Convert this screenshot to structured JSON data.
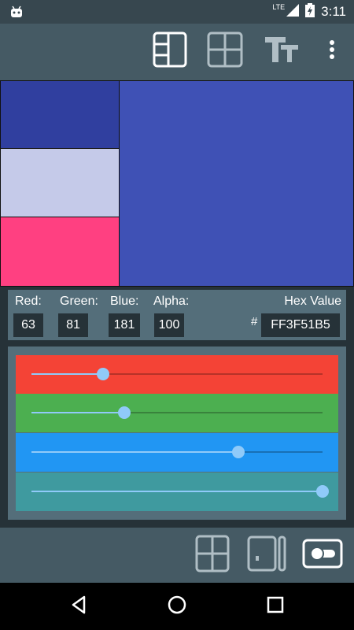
{
  "status": {
    "network": "LTE",
    "time": "3:11"
  },
  "colors": {
    "primary": "#3f51b5",
    "swatch_dark": "#303f9f",
    "swatch_light": "#c5cae9",
    "swatch_accent": "#ff4081",
    "slider_red": "#f44336",
    "slider_green": "#4caf50",
    "slider_blue": "#2196f3",
    "slider_alpha": "#3f9a9f"
  },
  "toolbar": {
    "icons": [
      "layout-split-icon",
      "grid-icon",
      "text-size-icon",
      "more-vert-icon"
    ]
  },
  "values": {
    "red_label": "Red:",
    "green_label": "Green:",
    "blue_label": "Blue:",
    "alpha_label": "Alpha:",
    "hex_label": "Hex Value",
    "hash": "#",
    "red": "63",
    "green": "81",
    "blue": "181",
    "alpha": "100",
    "hex": "FF3F51B5"
  },
  "sliders": {
    "red_level": 0.247,
    "green_level": 0.318,
    "blue_level": 0.71,
    "alpha_level": 1.0
  },
  "bottombar": {
    "icons": [
      "grid-icon",
      "panel-layout-icon",
      "toggle-icon"
    ]
  },
  "navbar": {
    "icons": [
      "back-icon",
      "home-icon",
      "recents-icon"
    ]
  }
}
